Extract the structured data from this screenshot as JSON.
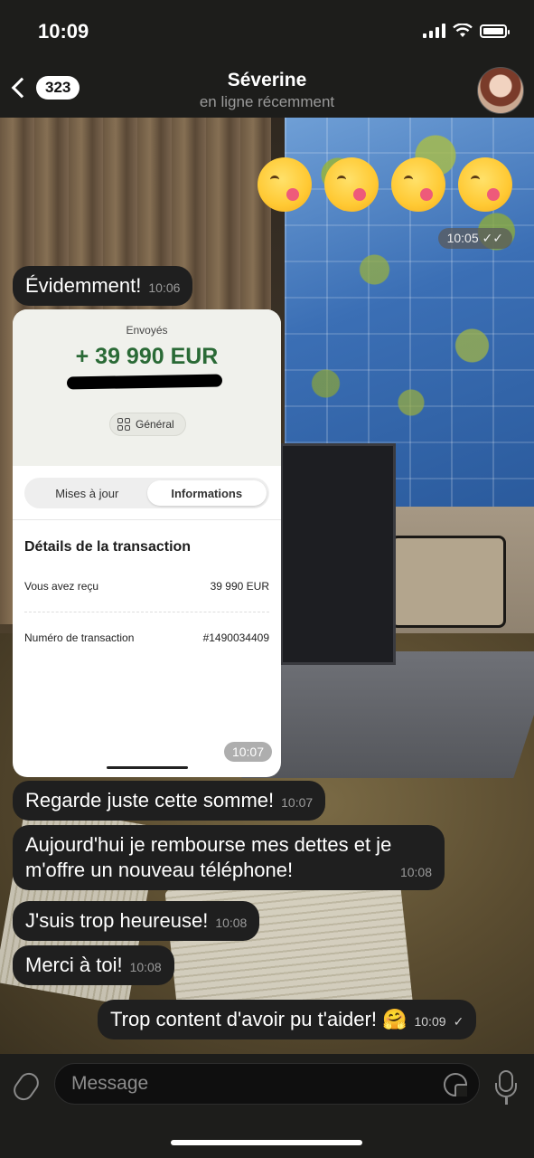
{
  "status_bar": {
    "time": "10:09"
  },
  "header": {
    "back_count": "323",
    "contact_name": "Séverine",
    "contact_status": "en ligne récemment"
  },
  "emoji_message": {
    "emoji_name": "face-savoring-food-icon",
    "count": 4,
    "time": "10:05"
  },
  "messages": [
    {
      "text": "Évidemment!",
      "time": "10:06",
      "direction": "in"
    },
    {
      "text": "Regarde juste cette somme!",
      "time": "10:07",
      "direction": "in"
    },
    {
      "text": "Aujourd'hui je rembourse mes dettes et je m'offre un nouveau téléphone!",
      "time": "10:08",
      "direction": "in"
    },
    {
      "text": "J'suis trop heureuse!",
      "time": "10:08",
      "direction": "in"
    },
    {
      "text": "Merci à toi!",
      "time": "10:08",
      "direction": "in"
    },
    {
      "text": "Trop content d'avoir pu t'aider! 🤗",
      "time": "10:09",
      "direction": "out"
    }
  ],
  "screenshot_card": {
    "label": "Envoyés",
    "amount": "+ 39 990 EUR",
    "chip": "Général",
    "tab_updates": "Mises à jour",
    "tab_info": "Informations",
    "section_title": "Détails de la transaction",
    "received_label": "Vous avez reçu",
    "received_value": "39 990 EUR",
    "txn_label": "Numéro de transaction",
    "txn_value": "#1490034409",
    "time": "10:07"
  },
  "input": {
    "placeholder": "Message"
  },
  "colors": {
    "header_bg": "#1d1d1b",
    "bubble_in": "#1f1f1f",
    "amount_green": "#2a6a36"
  }
}
